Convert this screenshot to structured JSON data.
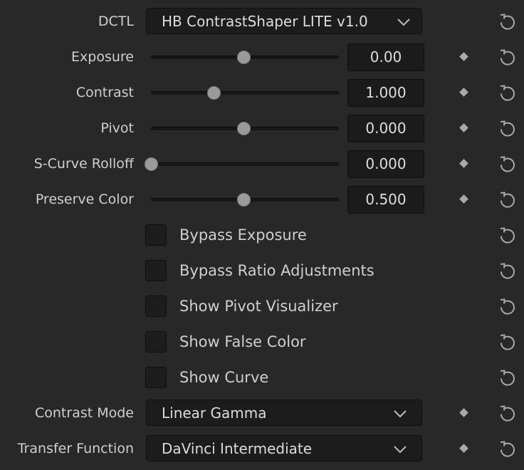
{
  "dctl": {
    "label": "DCTL",
    "selected": "HB ContrastShaper LITE v1.0"
  },
  "sliders": [
    {
      "label": "Exposure",
      "value_text": "0.00",
      "position_fraction": 0.495
    },
    {
      "label": "Contrast",
      "value_text": "1.000",
      "position_fraction": 0.335
    },
    {
      "label": "Pivot",
      "value_text": "0.000",
      "position_fraction": 0.495
    },
    {
      "label": "S-Curve Rolloff",
      "value_text": "0.000",
      "position_fraction": 0.0
    },
    {
      "label": "Preserve Color",
      "value_text": "0.500",
      "position_fraction": 0.495
    }
  ],
  "checkboxes": [
    {
      "label": "Bypass Exposure",
      "checked": false
    },
    {
      "label": "Bypass Ratio Adjustments",
      "checked": false
    },
    {
      "label": "Show Pivot Visualizer",
      "checked": false
    },
    {
      "label": "Show False Color",
      "checked": false
    },
    {
      "label": "Show Curve",
      "checked": false
    }
  ],
  "contrast_mode": {
    "label": "Contrast Mode",
    "selected": "Linear Gamma"
  },
  "transfer_function": {
    "label": "Transfer Function",
    "selected": "DaVinci Intermediate"
  },
  "icons": {
    "reset": "reset-icon",
    "keyframe": "keyframe-diamond-icon",
    "dropdown": "chevron-down-icon"
  },
  "colors": {
    "background": "#282828",
    "field": "#1c1c1c",
    "text": "#cfcfcf",
    "thumb": "#9a9a9a"
  }
}
